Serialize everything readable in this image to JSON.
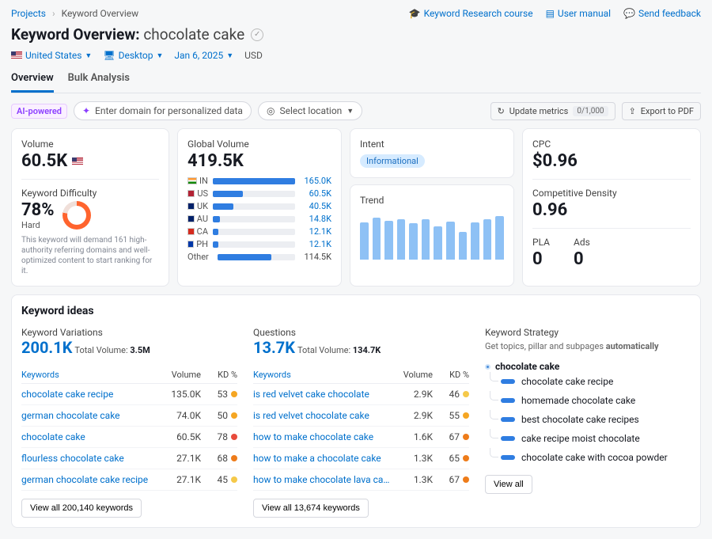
{
  "breadcrumb": {
    "parent": "Projects",
    "current": "Keyword Overview"
  },
  "toplinks": {
    "course": "Keyword Research course",
    "manual": "User manual",
    "feedback": "Send feedback"
  },
  "title_prefix": "Keyword Overview:",
  "keyword": "chocolate cake",
  "filters": {
    "country": "United States",
    "device": "Desktop",
    "date": "Jan 6, 2025",
    "currency": "USD"
  },
  "tabs": {
    "overview": "Overview",
    "bulk": "Bulk Analysis"
  },
  "toolbar": {
    "ai_badge": "AI-powered",
    "domain_placeholder": "Enter domain for personalized data",
    "location_label": "Select location",
    "update_label": "Update metrics",
    "update_count": "0/1,000",
    "export_label": "Export to PDF"
  },
  "volume": {
    "label": "Volume",
    "value": "60.5K"
  },
  "kd": {
    "label": "Keyword Difficulty",
    "value": "78%",
    "level": "Hard",
    "desc": "This keyword will demand 161 high-authority referring domains and well-optimized content to start ranking for it."
  },
  "global": {
    "label": "Global Volume",
    "value": "419.5K",
    "rows": [
      {
        "cc": "IN",
        "val": "165.0K",
        "pct": 100,
        "flag": "linear-gradient(#ff9933 0 33%,#fff 33% 66%,#138808 66% 100%)"
      },
      {
        "cc": "US",
        "val": "60.5K",
        "pct": 37,
        "flag": "#b22234"
      },
      {
        "cc": "UK",
        "val": "40.5K",
        "pct": 25,
        "flag": "#012169"
      },
      {
        "cc": "AU",
        "val": "14.8K",
        "pct": 9,
        "flag": "#012169"
      },
      {
        "cc": "CA",
        "val": "12.1K",
        "pct": 7,
        "flag": "#d52b1e"
      },
      {
        "cc": "PH",
        "val": "12.1K",
        "pct": 7,
        "flag": "#0038a8"
      }
    ],
    "other_label": "Other",
    "other_val": "114.5K",
    "other_pct": 69
  },
  "intent": {
    "label": "Intent",
    "value": "Informational"
  },
  "trend": {
    "label": "Trend"
  },
  "cpc": {
    "label": "CPC",
    "value": "$0.96"
  },
  "density": {
    "label": "Competitive Density",
    "value": "0.96"
  },
  "pla": {
    "label": "PLA",
    "value": "0"
  },
  "ads": {
    "label": "Ads",
    "value": "0"
  },
  "ideas_header": "Keyword ideas",
  "variations": {
    "title": "Keyword Variations",
    "main": "200.1K",
    "sub_label": "Total Volume:",
    "sub_val": "3.5M",
    "col_kw": "Keywords",
    "col_vol": "Volume",
    "col_kd": "KD %",
    "rows": [
      {
        "kw": "chocolate cake recipe",
        "vol": "135.0K",
        "kd": "53",
        "color": "#f5a623"
      },
      {
        "kw": "german chocolate cake",
        "vol": "74.0K",
        "kd": "50",
        "color": "#f5a623"
      },
      {
        "kw": "chocolate cake",
        "vol": "60.5K",
        "kd": "78",
        "color": "#e84b3c"
      },
      {
        "kw": "flourless chocolate cake",
        "vol": "27.1K",
        "kd": "68",
        "color": "#ee7c1a"
      },
      {
        "kw": "german chocolate cake recipe",
        "vol": "27.1K",
        "kd": "45",
        "color": "#f5c94a"
      }
    ],
    "viewall": "View all 200,140 keywords"
  },
  "questions": {
    "title": "Questions",
    "main": "13.7K",
    "sub_label": "Total Volume:",
    "sub_val": "134.7K",
    "col_kw": "Keywords",
    "col_vol": "Volume",
    "col_kd": "KD %",
    "rows": [
      {
        "kw": "is red velvet cake chocolate",
        "vol": "2.9K",
        "kd": "46",
        "color": "#f5c94a"
      },
      {
        "kw": "is red velvet chocolate cake",
        "vol": "2.9K",
        "kd": "55",
        "color": "#f5a623"
      },
      {
        "kw": "how to make chocolate cake",
        "vol": "1.6K",
        "kd": "67",
        "color": "#ee7c1a"
      },
      {
        "kw": "how to make a chocolate cake",
        "vol": "1.3K",
        "kd": "65",
        "color": "#ee7c1a"
      },
      {
        "kw": "how to make chocolate lava cake",
        "vol": "1.3K",
        "kd": "67",
        "color": "#ee7c1a"
      }
    ],
    "viewall": "View all 13,674 keywords"
  },
  "strategy": {
    "title": "Keyword Strategy",
    "desc_a": "Get topics, pillar and subpages ",
    "desc_b": "automatically",
    "root": "chocolate cake",
    "items": [
      "chocolate cake recipe",
      "homemade chocolate cake",
      "best chocolate cake recipes",
      "cake recipe moist chocolate",
      "chocolate cake with cocoa powder"
    ],
    "viewall": "View all"
  },
  "chart_data": {
    "type": "bar",
    "title": "Trend",
    "categories": [
      "m1",
      "m2",
      "m3",
      "m4",
      "m5",
      "m6",
      "m7",
      "m8",
      "m9",
      "m10",
      "m11",
      "m12"
    ],
    "values": [
      78,
      88,
      82,
      85,
      76,
      85,
      70,
      80,
      58,
      78,
      85,
      92
    ],
    "ylim": [
      0,
      100
    ]
  }
}
